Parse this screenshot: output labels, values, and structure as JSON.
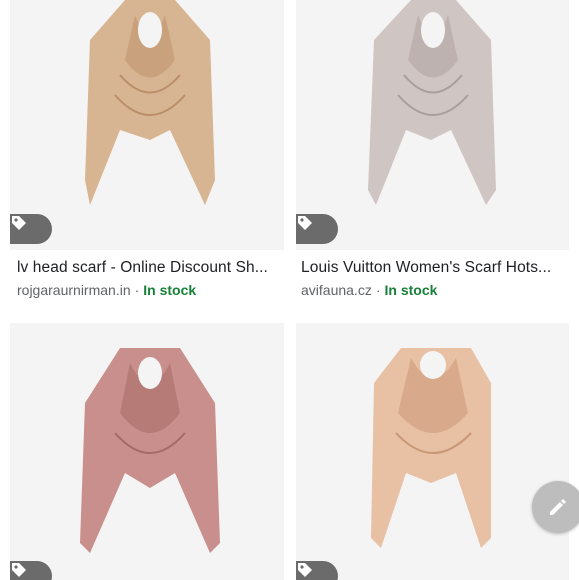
{
  "results": [
    {
      "title": "lv head scarf - Online Discount Sh...",
      "source": "rojgaraurnirman.in",
      "separator": "·",
      "stock": "In stock",
      "scarf_color": "#d8b592",
      "scarf_shade": "#c9a27d",
      "image_icon": "tag-icon"
    },
    {
      "title": "Louis Vuitton Women's Scarf Hots...",
      "source": "avifauna.cz",
      "separator": "·",
      "stock": "In stock",
      "scarf_color": "#cfc6c4",
      "scarf_shade": "#bdb2af",
      "image_icon": "tag-icon"
    },
    {
      "scarf_color": "#c98f8c",
      "scarf_shade": "#b67a77",
      "image_icon": "tag-icon"
    },
    {
      "scarf_color": "#e8c0a4",
      "scarf_shade": "#d8a98a",
      "image_icon": "tag-icon"
    }
  ],
  "fab": {
    "icon": "pencil-icon"
  },
  "colors": {
    "stock_green": "#188038",
    "badge": "#6b6b6b",
    "fab": "#bdbdbd"
  }
}
